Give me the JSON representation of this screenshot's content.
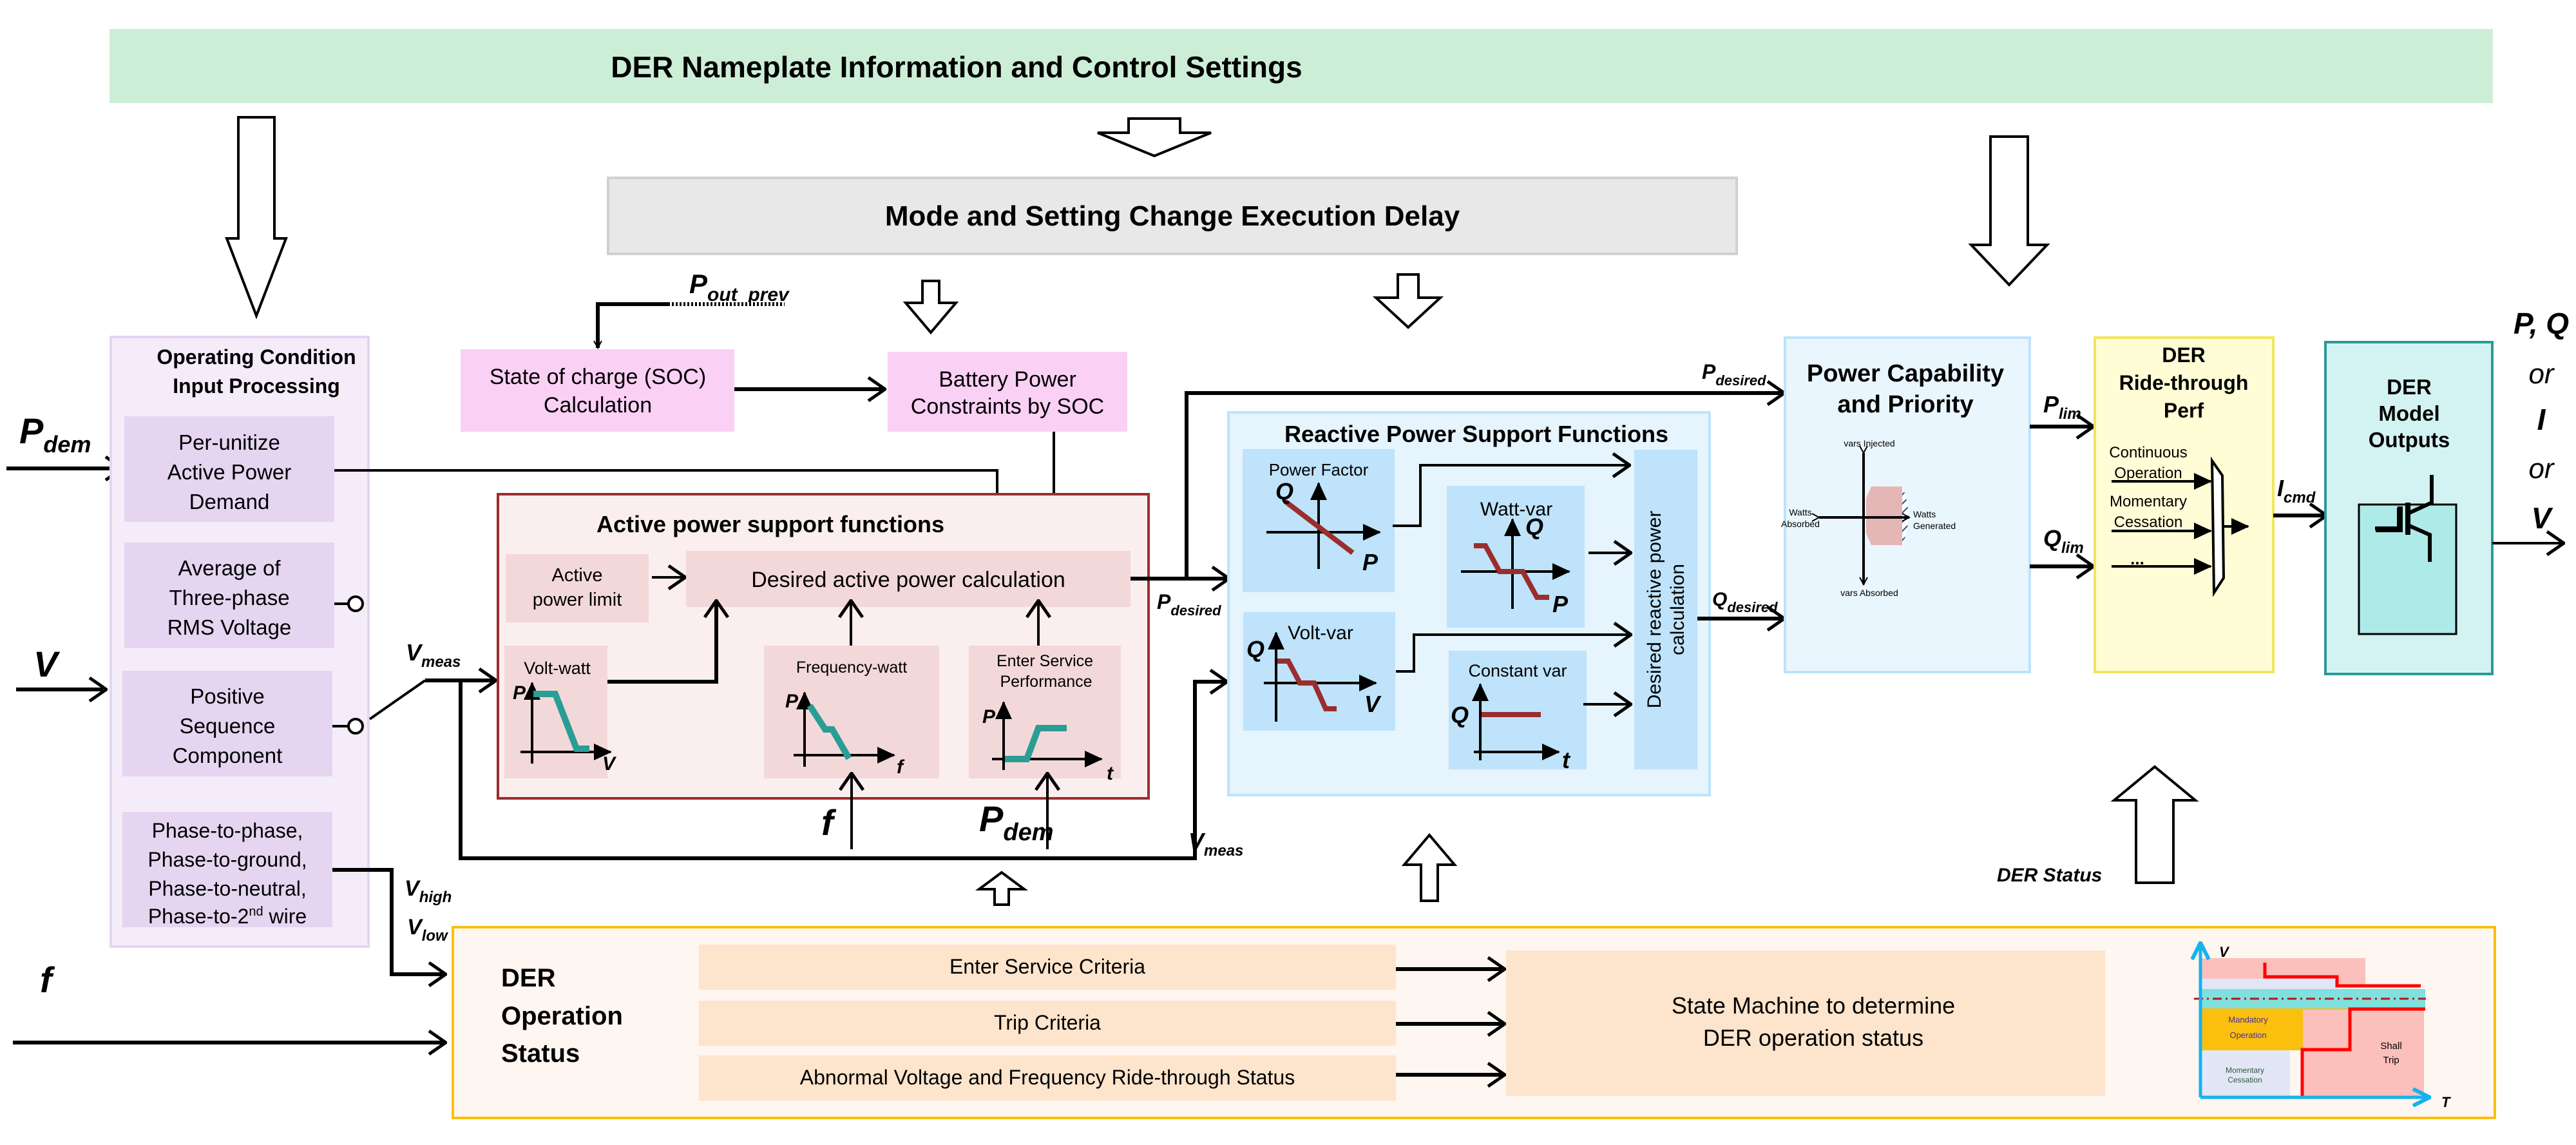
{
  "banner": {
    "title": "DER Nameplate Information and Control Settings"
  },
  "delay": {
    "title": "Mode and Setting Change Execution Delay"
  },
  "inputs": {
    "p_dem": {
      "main": "P",
      "sub": "dem"
    },
    "v": {
      "main": "V"
    },
    "f": {
      "main": "f"
    }
  },
  "operating": {
    "title_lines": [
      "Operating Condition",
      "Input Processing"
    ],
    "blocks": [
      {
        "lines": [
          "Per-unitize",
          "Active Power",
          "Demand"
        ]
      },
      {
        "lines": [
          "Average of",
          "Three-phase",
          "RMS Voltage"
        ]
      },
      {
        "lines": [
          "Positive",
          "Sequence",
          "Component"
        ]
      },
      {
        "lines": [
          "Phase-to-phase,",
          "Phase-to-ground,",
          "Phase-to-neutral,",
          "Phase-to-2",
          "nd",
          " wire"
        ]
      }
    ]
  },
  "signals": {
    "v_meas": {
      "main": "V",
      "sub": "meas"
    },
    "v_high": {
      "main": "V",
      "sub": "high"
    },
    "v_low": {
      "main": "V",
      "sub": "low"
    },
    "p_out_prev": {
      "main": "P",
      "sub": "out_prev"
    },
    "p_desired": {
      "main": "P",
      "sub": "desired"
    },
    "q_desired": {
      "main": "Q",
      "sub": "desired"
    },
    "p_lim": {
      "main": "P",
      "sub": "lim"
    },
    "q_lim": {
      "main": "Q",
      "sub": "lim"
    },
    "i_cmd": {
      "main": "I",
      "sub": "cmd"
    },
    "f_in": {
      "main": "f"
    },
    "p_dem_in": {
      "main": "P",
      "sub": "dem"
    },
    "der_status": "DER Status"
  },
  "soc": {
    "lines": [
      "State of charge (SOC)",
      "Calculation"
    ]
  },
  "battery": {
    "lines": [
      "Battery Power",
      "Constraints by SOC"
    ]
  },
  "active": {
    "title": "Active power support functions",
    "limit_lines": [
      "Active",
      "power limit"
    ],
    "calc": "Desired active power calculation",
    "volt_watt": {
      "title": "Volt-watt",
      "y": "P",
      "x": "V"
    },
    "freq_watt": {
      "title": "Frequency-watt",
      "y": "P",
      "x": "f"
    },
    "enter_service": {
      "title_lines": [
        "Enter Service",
        "Performance"
      ],
      "y": "P",
      "x": "t"
    }
  },
  "reactive": {
    "title": "Reactive Power Support Functions",
    "power_factor": {
      "title": "Power Factor",
      "y": "Q",
      "x": "P"
    },
    "watt_var": {
      "title": "Watt-var",
      "y": "Q",
      "x": "P"
    },
    "volt_var": {
      "title": "Volt-var",
      "y": "Q",
      "x": "V"
    },
    "constant_var": {
      "title": "Constant var",
      "y": "Q",
      "x": "t"
    },
    "calc_lines": [
      "Desired reactive power",
      "calculation"
    ]
  },
  "capability": {
    "title_lines": [
      "Power Capability",
      "and Priority"
    ],
    "labels": {
      "top": "vars Injected",
      "bottom": "vars Absorbed",
      "left": [
        "Watts",
        "Absorbed"
      ],
      "right": [
        "Watts",
        "Generated"
      ]
    }
  },
  "ridethrough": {
    "title_lines": [
      "DER",
      "Ride-through",
      "Perf"
    ],
    "inputs": [
      [
        "Continuous",
        "Operation"
      ],
      [
        "Momentary",
        "Cessation"
      ],
      [
        "..."
      ]
    ]
  },
  "model": {
    "title_lines": [
      "DER",
      "Model",
      "Outputs"
    ]
  },
  "outputs": {
    "lines": [
      "P, Q",
      "or",
      "I",
      "or",
      "V"
    ]
  },
  "operation_status": {
    "title_lines": [
      "DER",
      "Operation",
      "Status"
    ],
    "criteria": [
      "Enter Service Criteria",
      "Trip Criteria",
      "Abnormal Voltage and Frequency Ride-through Status"
    ],
    "state_machine_lines": [
      "State Machine to determine",
      "DER operation status"
    ]
  },
  "ride_chart": {
    "y": "V",
    "x": "T",
    "regions": [
      "Mandatory",
      "Operation",
      "Momentary",
      "Cessation",
      "Shall",
      "Trip"
    ]
  },
  "colors": {
    "banner": "#cdeed6",
    "delay": "#e8e8e8",
    "operating_bg": "#f5ecfa",
    "operating_block": "#e5d5f1",
    "soc": "#fbd0f5",
    "active_bg": "#fbeeee",
    "active_block": "#f3d8da",
    "active_border": "#9b2d2d",
    "reactive_bg": "#e6f4fe",
    "reactive_block": "#bee3fb",
    "capability_bg": "#eaf6fd",
    "ride_bg": "#fefdd6",
    "ride_border": "#f2e55b",
    "model_bg": "#d3f3f2",
    "model_border": "#2b9a98",
    "status_bg": "#fef6f0",
    "status_border": "#fbbf0e",
    "status_block": "#fde4cc",
    "curve_active": "#2a9d94",
    "curve_reactive": "#9b2d2d"
  }
}
